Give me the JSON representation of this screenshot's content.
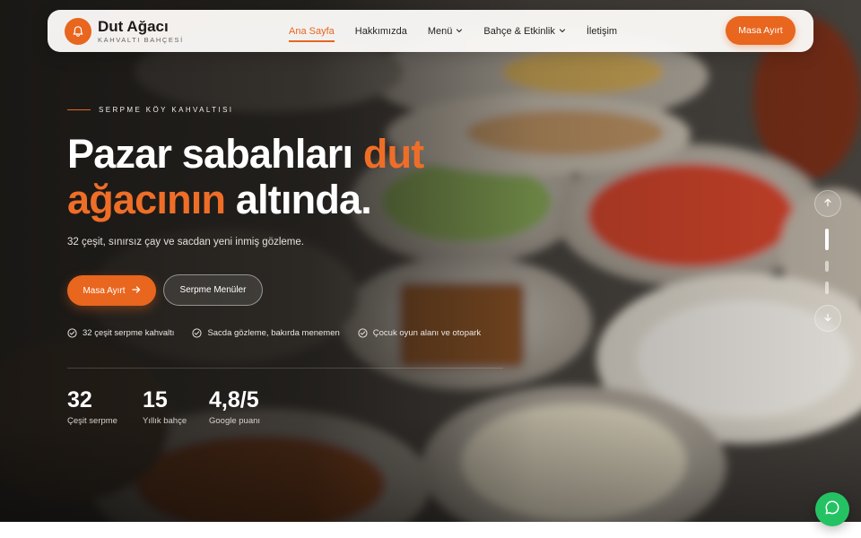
{
  "brand": {
    "name": "Dut Ağacı",
    "tagline": "KAHVALTI BAHÇESİ",
    "accent_color": "#e8661e",
    "icon": "bell-icon"
  },
  "nav": {
    "items": [
      {
        "label": "Ana Sayfa",
        "active": true,
        "has_dropdown": false
      },
      {
        "label": "Hakkımızda",
        "active": false,
        "has_dropdown": false
      },
      {
        "label": "Menü",
        "active": false,
        "has_dropdown": true
      },
      {
        "label": "Bahçe & Etkinlik",
        "active": false,
        "has_dropdown": true
      },
      {
        "label": "İletişim",
        "active": false,
        "has_dropdown": false
      }
    ],
    "cta_label": "Masa Ayırt"
  },
  "hero": {
    "eyebrow": "SERPME KÖY KAHVALTISI",
    "headline": {
      "part1": "Pazar sabahları ",
      "accent1": "dut",
      "accent2": "ağacının",
      "part2": " altında."
    },
    "lead": "32 çeşit, sınırsız çay ve sacdan yeni inmiş gözleme.",
    "primary_button": "Masa Ayırt",
    "primary_button_icon": "arrow-right-icon",
    "secondary_button": "Serpme Menüler",
    "features": [
      "32 çeşit serpme kahvaltı",
      "Sacda gözleme, bakırda menemen",
      "Çocuk oyun alanı ve otopark"
    ],
    "stats": [
      {
        "value": "32",
        "label": "Çeşit serpme"
      },
      {
        "value": "15",
        "label": "Yıllık bahçe"
      },
      {
        "value": "4,8/5",
        "label": "Google puanı"
      }
    ]
  },
  "slider": {
    "prev_icon": "arrow-up-icon",
    "next_icon": "arrow-down-icon",
    "slide_count": 3,
    "active_index": 0
  },
  "chat": {
    "icon": "whatsapp-icon",
    "color": "#25c263"
  }
}
